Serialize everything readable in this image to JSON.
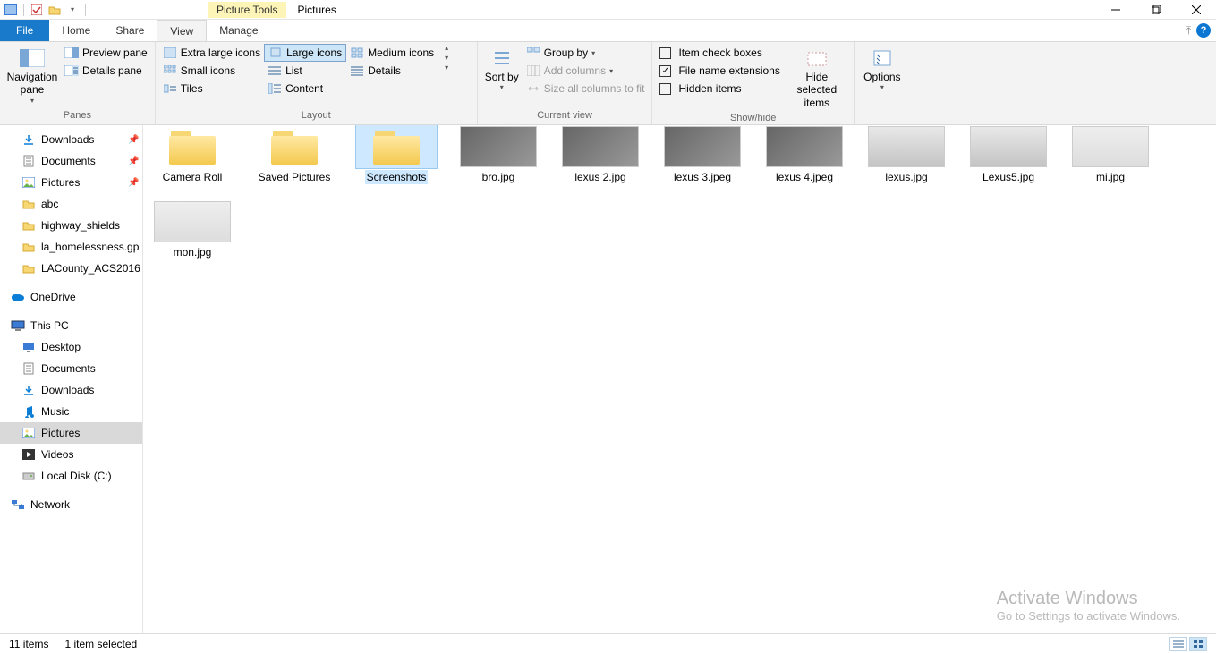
{
  "title": {
    "tools_label": "Picture Tools",
    "tab_label": "Pictures"
  },
  "tabs": {
    "file": "File",
    "home": "Home",
    "share": "Share",
    "view": "View",
    "manage": "Manage"
  },
  "ribbon": {
    "panes": {
      "nav_pane": "Navigation pane",
      "preview": "Preview pane",
      "details": "Details pane",
      "group": "Panes"
    },
    "layout": {
      "xl": "Extra large icons",
      "large": "Large icons",
      "medium": "Medium icons",
      "small": "Small icons",
      "list": "List",
      "details": "Details",
      "tiles": "Tiles",
      "content": "Content",
      "group": "Layout"
    },
    "current": {
      "sort_by": "Sort by",
      "group_by": "Group by",
      "add_cols": "Add columns",
      "size_all": "Size all columns to fit",
      "group": "Current view"
    },
    "showhide": {
      "item_check": "Item check boxes",
      "file_ext": "File name extensions",
      "hidden": "Hidden items",
      "hide_selected": "Hide selected items",
      "group": "Show/hide"
    },
    "options": "Options"
  },
  "nav": {
    "quick": [
      {
        "label": "Downloads",
        "icon": "download",
        "pinned": true
      },
      {
        "label": "Documents",
        "icon": "doc",
        "pinned": true
      },
      {
        "label": "Pictures",
        "icon": "pic",
        "pinned": true
      },
      {
        "label": "abc",
        "icon": "folder"
      },
      {
        "label": "highway_shields",
        "icon": "folder"
      },
      {
        "label": "la_homelessness.gp",
        "icon": "folder"
      },
      {
        "label": "LACounty_ACS2016",
        "icon": "folder"
      }
    ],
    "onedrive": "OneDrive",
    "thispc": "This PC",
    "pc": [
      {
        "label": "Desktop",
        "icon": "desktop"
      },
      {
        "label": "Documents",
        "icon": "doc"
      },
      {
        "label": "Downloads",
        "icon": "download"
      },
      {
        "label": "Music",
        "icon": "music"
      },
      {
        "label": "Pictures",
        "icon": "pic",
        "selected": true
      },
      {
        "label": "Videos",
        "icon": "video"
      },
      {
        "label": "Local Disk (C:)",
        "icon": "disk"
      }
    ],
    "network": "Network"
  },
  "items": [
    {
      "name": "Camera Roll",
      "type": "folder"
    },
    {
      "name": "Saved Pictures",
      "type": "folder"
    },
    {
      "name": "Screenshots",
      "type": "folder",
      "selected": true
    },
    {
      "name": "bro.jpg",
      "type": "img",
      "variant": "eng"
    },
    {
      "name": "lexus 2.jpg",
      "type": "img",
      "variant": "eng"
    },
    {
      "name": "lexus 3.jpeg",
      "type": "img",
      "variant": "int"
    },
    {
      "name": "lexus 4.jpeg",
      "type": "img",
      "variant": "int"
    },
    {
      "name": "lexus.jpg",
      "type": "img",
      "variant": "car"
    },
    {
      "name": "Lexus5.jpg",
      "type": "img",
      "variant": "car"
    },
    {
      "name": "mi.jpg",
      "type": "img",
      "variant": "desk"
    },
    {
      "name": "mon.jpg",
      "type": "img",
      "variant": "desk"
    }
  ],
  "status": {
    "count": "11 items",
    "selection": "1 item selected"
  },
  "watermark": {
    "title": "Activate Windows",
    "sub": "Go to Settings to activate Windows."
  }
}
